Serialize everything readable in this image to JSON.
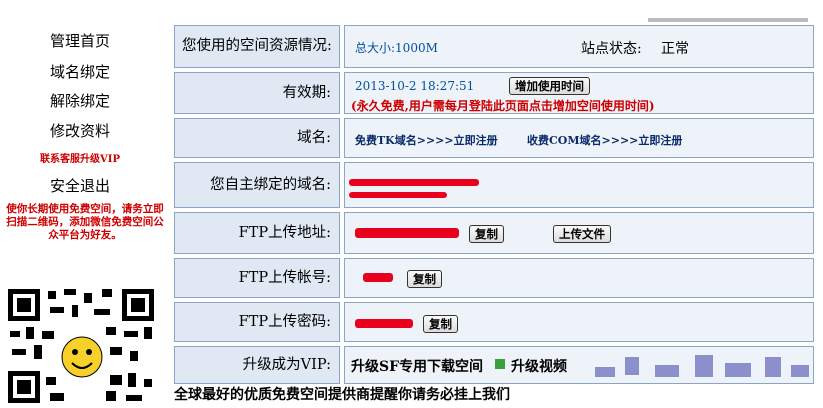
{
  "sidebar": {
    "items": [
      "管理首页",
      "域名绑定",
      "解除绑定",
      "修改资料",
      "联系客服升级VIP",
      "安全退出"
    ],
    "promo": "使你长期使用免费空间，请务立即扫描二维码，添加微信免费空间公众平台为好友。"
  },
  "table": {
    "space_label": "您使用的空间资源情况:",
    "space_total": "总大小:1000M",
    "status_label": "站点状态:",
    "status_value": "正常",
    "expiry_label": "有效期:",
    "expiry_date": "2013-10-2 18:27:51",
    "add_time_button": "增加使用时间",
    "expiry_notice": "(永久免费,用户需每月登陆此页面点击增加空间使用时间)",
    "domain_label": "域名:",
    "domain_tk_link": "免费TK域名>>>>立即注册",
    "domain_com_link": "收费COM域名>>>>立即注册",
    "bound_domain_label": "您自主绑定的域名:",
    "ftp_address_label": "FTP上传地址:",
    "copy_button": "复制",
    "upload_button": "上传文件",
    "ftp_account_label": "FTP上传帐号:",
    "ftp_password_label": "FTP上传密码:",
    "vip_label": "升级成为VIP:",
    "vip_link1": "升级SF专用下载空间",
    "vip_link2": "升级视频"
  },
  "footer": "全球最好的优质免费空间提供商提醒你请务必挂上我们"
}
